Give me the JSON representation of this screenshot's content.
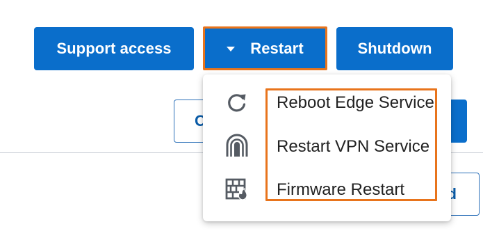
{
  "toolbar": {
    "support_access_label": "Support access",
    "restart_label": "Restart",
    "shutdown_label": "Shutdown"
  },
  "background": {
    "partial_button_text": "C",
    "partial_button_text_2": "d"
  },
  "restart_menu": {
    "items": [
      {
        "label": "Reboot Edge Service",
        "icon": "refresh-icon"
      },
      {
        "label": "Restart VPN Service",
        "icon": "tunnel-icon"
      },
      {
        "label": "Firmware Restart",
        "icon": "firmware-wall-icon"
      }
    ]
  },
  "colors": {
    "primary_button": "#0a6ecb",
    "highlight_outline": "#e8741c",
    "menu_text": "#222222",
    "icon_gray": "#555b63"
  }
}
